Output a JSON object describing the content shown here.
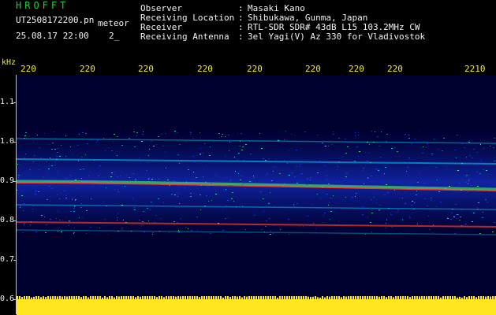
{
  "header": {
    "app_name": "HROFFT",
    "file_name": "UT2508172200.pn",
    "file_type": "meteor",
    "datetime": "25.08.17 22:00",
    "suffix": "2_"
  },
  "meta": [
    {
      "label": "Observer",
      "value": "Masaki Kano"
    },
    {
      "label": "Receiving Location",
      "value": "Shibukawa, Gunma, Japan"
    },
    {
      "label": "Receiver",
      "value": "RTL-SDR SDR# 43dB L15 103.2MHz CW"
    },
    {
      "label": "Receiving Antenna",
      "value": "3el Yagi(V) Az 330 for Vladivostok"
    }
  ],
  "axes": {
    "y_unit": "kHz",
    "x_ticks": [
      "220",
      "220",
      "220",
      "220",
      "220",
      "220",
      "220",
      "220",
      "2210"
    ],
    "y_ticks": [
      "1.1",
      "1.0",
      "0.9",
      "0.8",
      "0.7",
      "0.6"
    ]
  },
  "colors": {
    "background": "#000000",
    "plot_background": "#00002f",
    "text_green": "#1fcf3b",
    "text_white": "#f3f3f3",
    "text_yellow": "#f1ef2b",
    "signal_blue": "#1d3fff",
    "signal_cyan": "#00d6ff",
    "signal_green": "#3eff58",
    "signal_red": "#ff3a24",
    "signal_yellow": "#ffe61f"
  }
}
